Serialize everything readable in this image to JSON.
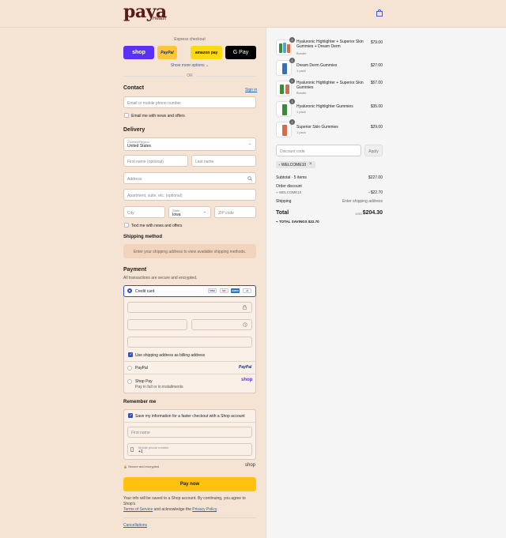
{
  "header": {
    "logo_text": "paya",
    "logo_sub": "Health"
  },
  "express": {
    "title": "Express checkout",
    "shop": "shop",
    "paypal": "PayPal",
    "amazon": "amazon pay",
    "gpay": "G Pay",
    "show_more": "Show more options ⌄",
    "or": "OR"
  },
  "contact": {
    "title": "Contact",
    "sign_in": "Sign in",
    "email_placeholder": "Email or mobile phone number",
    "news_label": "Email me with news and offers"
  },
  "delivery": {
    "title": "Delivery",
    "country_label": "Country/Region",
    "country_value": "United States",
    "first_name_placeholder": "First name (optional)",
    "last_name_placeholder": "Last name",
    "address_placeholder": "Address",
    "apartment_placeholder": "Apartment, suite, etc. (optional)",
    "city_placeholder": "City",
    "state_label": "State",
    "state_value": "Iowa",
    "zip_placeholder": "ZIP code",
    "text_label": "Text me with news and offers"
  },
  "shipping": {
    "title": "Shipping method",
    "notice": "Enter your shipping address to view available shipping methods."
  },
  "payment": {
    "title": "Payment",
    "subtitle": "All transactions are secure and encrypted.",
    "credit_card": "Credit card",
    "card_brands": [
      "VISA",
      "MC",
      "AMEX",
      "+5"
    ],
    "billing_label": "Use shipping address as billing address",
    "paypal": "PayPal",
    "paypal_logo": "PayPal",
    "shop_pay": "Shop Pay",
    "shop_pay_sub": "Pay in full or in installments",
    "shop_logo": "shop"
  },
  "remember": {
    "title": "Remember me",
    "save_label": "Save my information for a faster checkout with a Shop account",
    "first_name_placeholder": "First name",
    "phone_label": "Mobile phone number",
    "phone_value": "+1",
    "secure": "Secure and encrypted",
    "shop_logo": "shop"
  },
  "pay_now": "Pay now",
  "legal": {
    "text1": "Your info will be saved to a Shop account. By continuing, you agree to Shop's",
    "terms": "Terms of Service",
    "text2": " and acknowledge the ",
    "privacy": "Privacy Policy",
    "text3": "."
  },
  "footer": {
    "cancellations": "Cancellations"
  },
  "cart": {
    "items": [
      {
        "name": "Hyaluronic Highlighter + Superior Skin Gummies + Dream Derm",
        "sub": "Bundle",
        "price": "$79.00",
        "qty": "1"
      },
      {
        "name": "Dream Derm Gummies",
        "sub": "1 pack",
        "price": "$27.00",
        "qty": "1"
      },
      {
        "name": "Hyaluronic Highlighter + Superior Skin Gummies",
        "sub": "Bundle",
        "price": "$57.00",
        "qty": "1"
      },
      {
        "name": "Hyaluronic Highlighter Gummies",
        "sub": "1 pack",
        "price": "$35.00",
        "qty": "1"
      },
      {
        "name": "Superior Skin Gummies",
        "sub": "1 pack",
        "price": "$29.00",
        "qty": "1"
      }
    ],
    "discount_placeholder": "Discount code",
    "apply": "Apply",
    "discount_tag": "WELCOME10",
    "subtotal_label": "Subtotal · 5 items",
    "subtotal_value": "$227.00",
    "order_discount_label": "Order discount",
    "order_discount_code": "WELCOME10",
    "order_discount_value": "−$22.70",
    "shipping_label": "Shipping",
    "shipping_value": "Enter shipping address",
    "total_label": "Total",
    "currency": "USD",
    "total_value": "$204.30",
    "savings_label": "TOTAL SAVINGS",
    "savings_value": "$22.70"
  },
  "colors": {
    "accent": "#2c4fc8",
    "header_bg": "#f5e3d3",
    "pay_button": "#ffc20e",
    "shop_purple": "#5a31f4"
  }
}
